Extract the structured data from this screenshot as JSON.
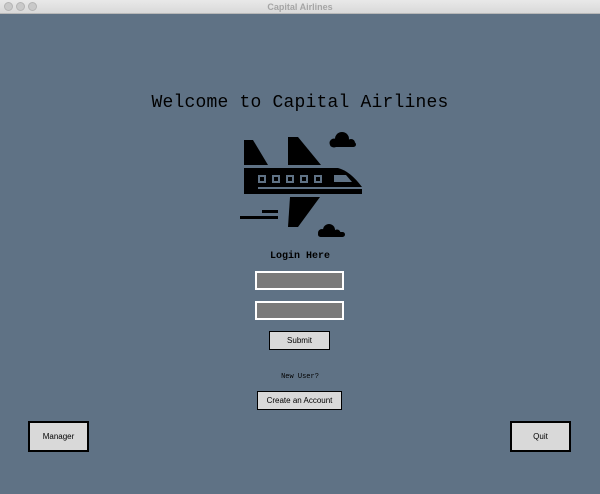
{
  "window": {
    "title": "Capital Airlines"
  },
  "main": {
    "welcome_text": "Welcome to Capital Airlines",
    "logo_icon": "airplane-with-clouds-icon",
    "login_heading": "Login Here",
    "username_value": "",
    "password_value": "",
    "submit_label": "Submit",
    "new_user_text": "New User?",
    "create_account_label": "Create an Account"
  },
  "footer": {
    "manager_label": "Manager",
    "quit_label": "Quit"
  },
  "colors": {
    "background": "#5f7285",
    "field_fill": "#7a7a7a",
    "field_border": "#ffffff",
    "button_fill": "#d9d9d9"
  }
}
